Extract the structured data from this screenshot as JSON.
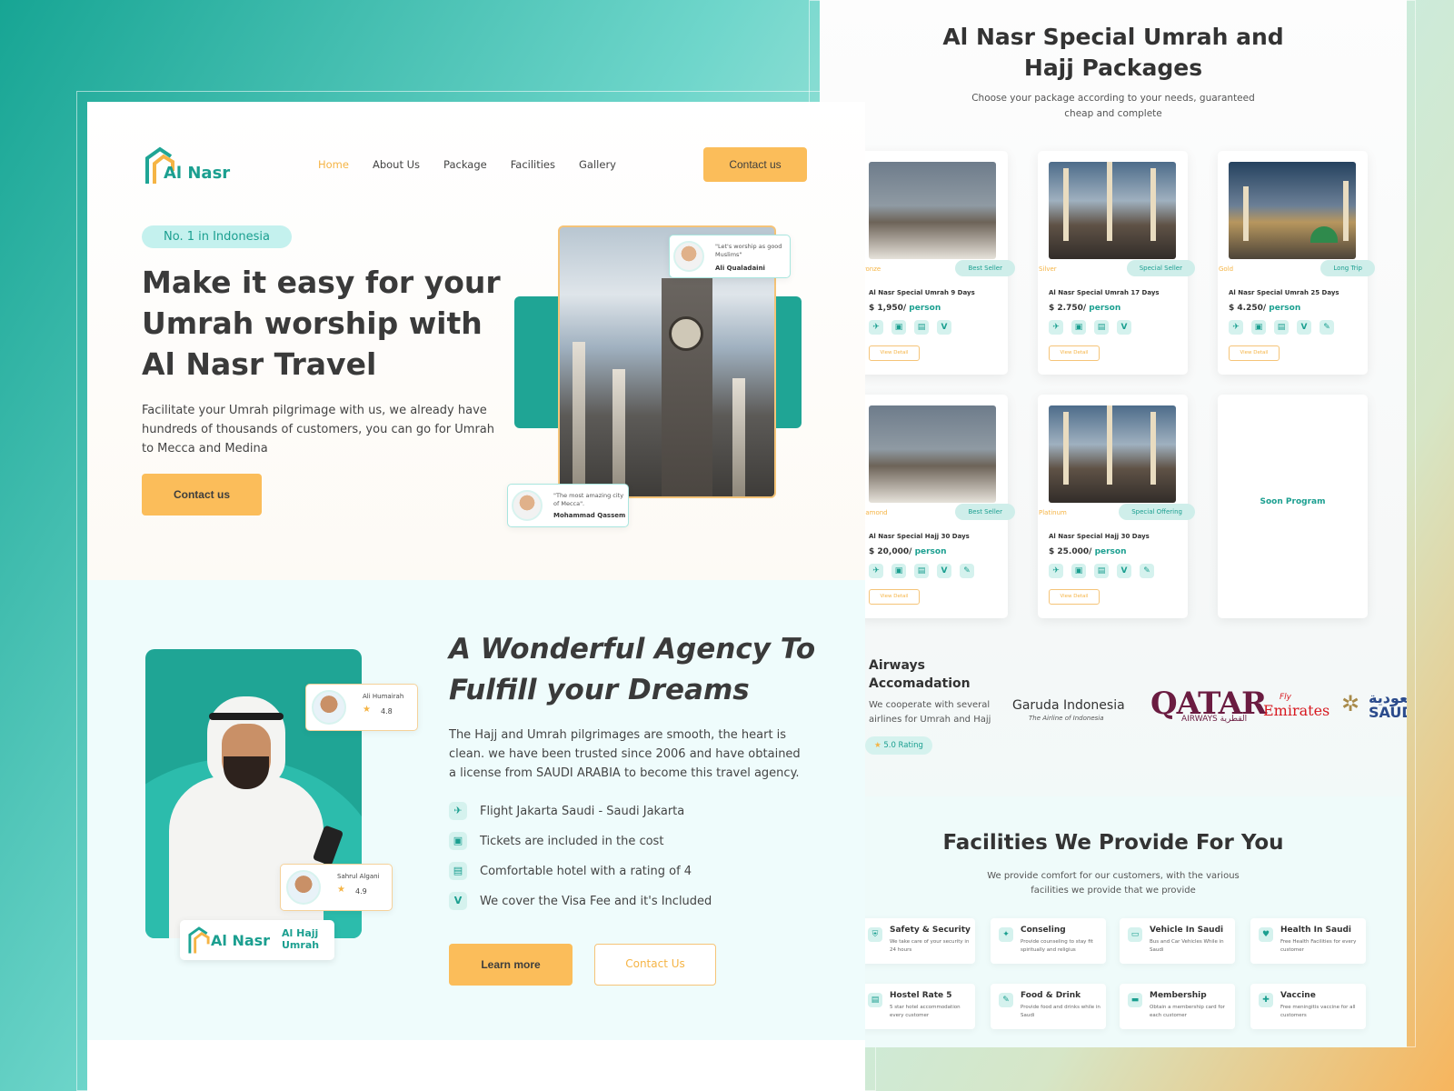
{
  "colors": {
    "primary": "#1fa595",
    "accent": "#fbbd5a",
    "text": "#3a3a3a"
  },
  "nav": {
    "logo": "Al Nasr",
    "items": [
      "Home",
      "About Us",
      "Package",
      "Facilities",
      "Gallery"
    ],
    "active": "Home",
    "contact_button": "Contact us"
  },
  "hero": {
    "badge": "No. 1 in Indonesia",
    "title_lines": [
      "Make it easy for your",
      "Umrah worship with",
      "Al Nasr Travel"
    ],
    "description": "Facilitate your Umrah pilgrimage with us, we already have hundreds of thousands of customers, you can go for Umrah to Mecca and Medina",
    "cta": "Contact us",
    "testimonials": [
      {
        "quote": "\"Let's worship as good Muslims\"",
        "name": "Ali Qualadaini"
      },
      {
        "quote": "\"The most amazing city of Mecca\".",
        "name": "Mohammad Qassem"
      }
    ]
  },
  "agency": {
    "title_lines": [
      "A Wonderful Agency To",
      "Fulfill your Dreams"
    ],
    "description": "The Hajj and Umrah pilgrimages are smooth, the heart is clean. we have been trusted since 2006 and have obtained a license from SAUDI ARABIA to become this travel agency.",
    "features": [
      {
        "icon": "plane-icon",
        "text": "Flight Jakarta Saudi - Saudi Jakarta"
      },
      {
        "icon": "ticket-icon",
        "text": "Tickets are included in the cost"
      },
      {
        "icon": "hotel-icon",
        "text": "Comfortable hotel with a rating of 4"
      },
      {
        "icon": "visa-icon",
        "text": "We cover the Visa Fee and it's Included"
      }
    ],
    "learn_more": "Learn more",
    "contact": "Contact Us",
    "reviews": [
      {
        "name": "Ali Humairah",
        "rating": "4.8"
      },
      {
        "name": "Sahrul Algani",
        "rating": "4.9"
      }
    ],
    "logo_text": "Al Nasr",
    "logo_sub": [
      "Al Hajj",
      "Umrah"
    ]
  },
  "packages": {
    "title_lines": [
      "Al Nasr Special Umrah and",
      "Hajj Packages"
    ],
    "subtitle_lines": [
      "Choose your package according to your needs, guaranteed",
      "cheap and complete"
    ],
    "cards": [
      {
        "tier": "Bronze",
        "badge": "Best Seller",
        "name": "Al Nasr Special Umrah 9 Days",
        "price": "$ 1,950/",
        "per": "person",
        "button": "View Detail"
      },
      {
        "tier": "Silver",
        "badge": "Special Seller",
        "name": "Al Nasr Special Umrah 17 Days",
        "price": "$ 2.750/",
        "per": "person",
        "button": "View Detail"
      },
      {
        "tier": "Gold",
        "badge": "Long Trip",
        "name": "Al Nasr Special Umrah 25 Days",
        "price": "$ 4.250/",
        "per": "person",
        "button": "View Detail"
      },
      {
        "tier": "Diamond",
        "badge": "Best Seller",
        "name": "Al Nasr Special Hajj 30 Days",
        "price": "$ 20,000/",
        "per": "person",
        "button": "View Detail"
      },
      {
        "tier": "Platinum",
        "badge": "Special Offering",
        "name": "Al Nasr Special Hajj 30 Days",
        "price": "$ 25.000/",
        "per": "person",
        "button": "View Detail"
      }
    ],
    "soon": "Soon Program"
  },
  "airways": {
    "title_lines": [
      "Airways",
      "Accomadation"
    ],
    "description": "We cooperate with several airlines for Umrah and Hajj",
    "rating": "5.0 Rating",
    "logos": {
      "garuda": "Garuda Indonesia",
      "garuda_sub": "The Airline of Indonesia",
      "qatar": "QATAR",
      "qatar_sub": "AIRWAYS القطرية",
      "fly": "Fly",
      "emirates": "Emirates",
      "saudi_ar": "السعودية",
      "saudi": "SAUDIA"
    }
  },
  "facilities": {
    "title": "Facilities We Provide For You",
    "subtitle_lines": [
      "We provide comfort for our customers, with the various",
      "facilities we provide that we provide"
    ],
    "items": [
      {
        "icon": "shield-icon",
        "name": "Safety & Security",
        "desc": "We take care of your security in 24 hours"
      },
      {
        "icon": "chat-icon",
        "name": "Conseling",
        "desc": "Provide counseling to stay fit spiritually and religius"
      },
      {
        "icon": "bus-icon",
        "name": "Vehicle In Saudi",
        "desc": "Bus and Car Vehicles While in Saudi"
      },
      {
        "icon": "heart-icon",
        "name": "Health In Saudi",
        "desc": "Free Health Facilities for every customer"
      },
      {
        "icon": "hotel-icon",
        "name": "Hostel Rate 5",
        "desc": "5 star hotel accommodation every customer"
      },
      {
        "icon": "food-icon",
        "name": "Food & Drink",
        "desc": "Provide food and drinks while in Saudi"
      },
      {
        "icon": "card-icon",
        "name": "Membership",
        "desc": "Obtain a membership card for each customer"
      },
      {
        "icon": "syringe-icon",
        "name": "Vaccine",
        "desc": "Free meningitis vaccine for all customers"
      }
    ]
  }
}
